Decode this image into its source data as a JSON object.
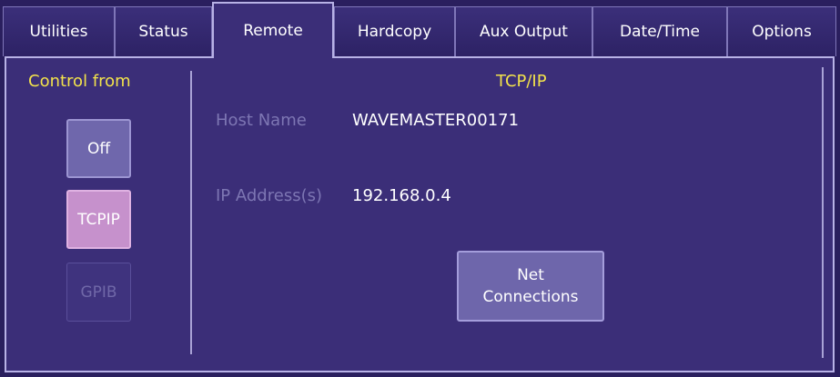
{
  "tabs": [
    {
      "label": "Utilities"
    },
    {
      "label": "Status"
    },
    {
      "label": "Remote"
    },
    {
      "label": "Hardcopy"
    },
    {
      "label": "Aux Output"
    },
    {
      "label": "Date/Time"
    },
    {
      "label": "Options"
    }
  ],
  "active_tab": "Remote",
  "control": {
    "title": "Control from",
    "buttons": {
      "off": "Off",
      "tcpip": "TCPIP",
      "gpib": "GPIB"
    },
    "selected": "TCPIP",
    "disabled": [
      "GPIB"
    ]
  },
  "tcpip": {
    "title": "TCP/IP",
    "host_label": "Host Name",
    "host_value": "WAVEMASTER00171",
    "ip_label": "IP Address(s)",
    "ip_value": "192.168.0.4",
    "net_button_line1": "Net",
    "net_button_line2": "Connections"
  },
  "colors": {
    "background": "#2a1f5e",
    "panel": "#3b2e78",
    "title_yellow": "#f2e24b",
    "selected_button": "#c691cc"
  }
}
